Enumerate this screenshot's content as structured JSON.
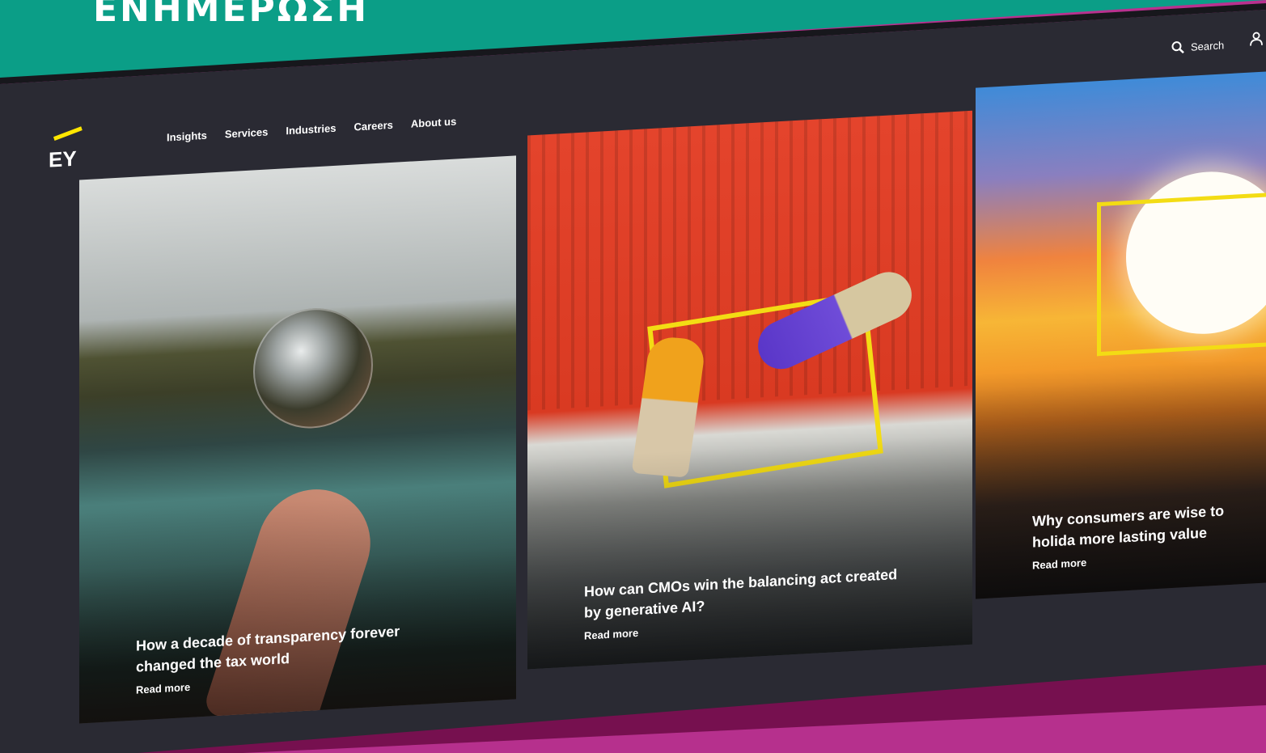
{
  "banner": {
    "title": "ΕΝΗΜΕΡΩΣΗ"
  },
  "site": {
    "logo": "EY",
    "nav": [
      "Insights",
      "Services",
      "Industries",
      "Careers",
      "About us"
    ],
    "search_label": "Search"
  },
  "cards": [
    {
      "headline": "How a decade of transparency forever changed the tax world",
      "link": "Read more"
    },
    {
      "headline": "How can CMOs win the balancing act created by generative AI?",
      "link": "Read more"
    },
    {
      "headline": "Why consumers are wise to holida more lasting value",
      "link": "Read more"
    }
  ],
  "colors": {
    "teal": "#0b9e87",
    "magenta": "#b6308d",
    "screen": "#2a2a33",
    "accent_yellow": "#ffe600"
  },
  "icons": [
    "search-icon",
    "user-icon"
  ]
}
